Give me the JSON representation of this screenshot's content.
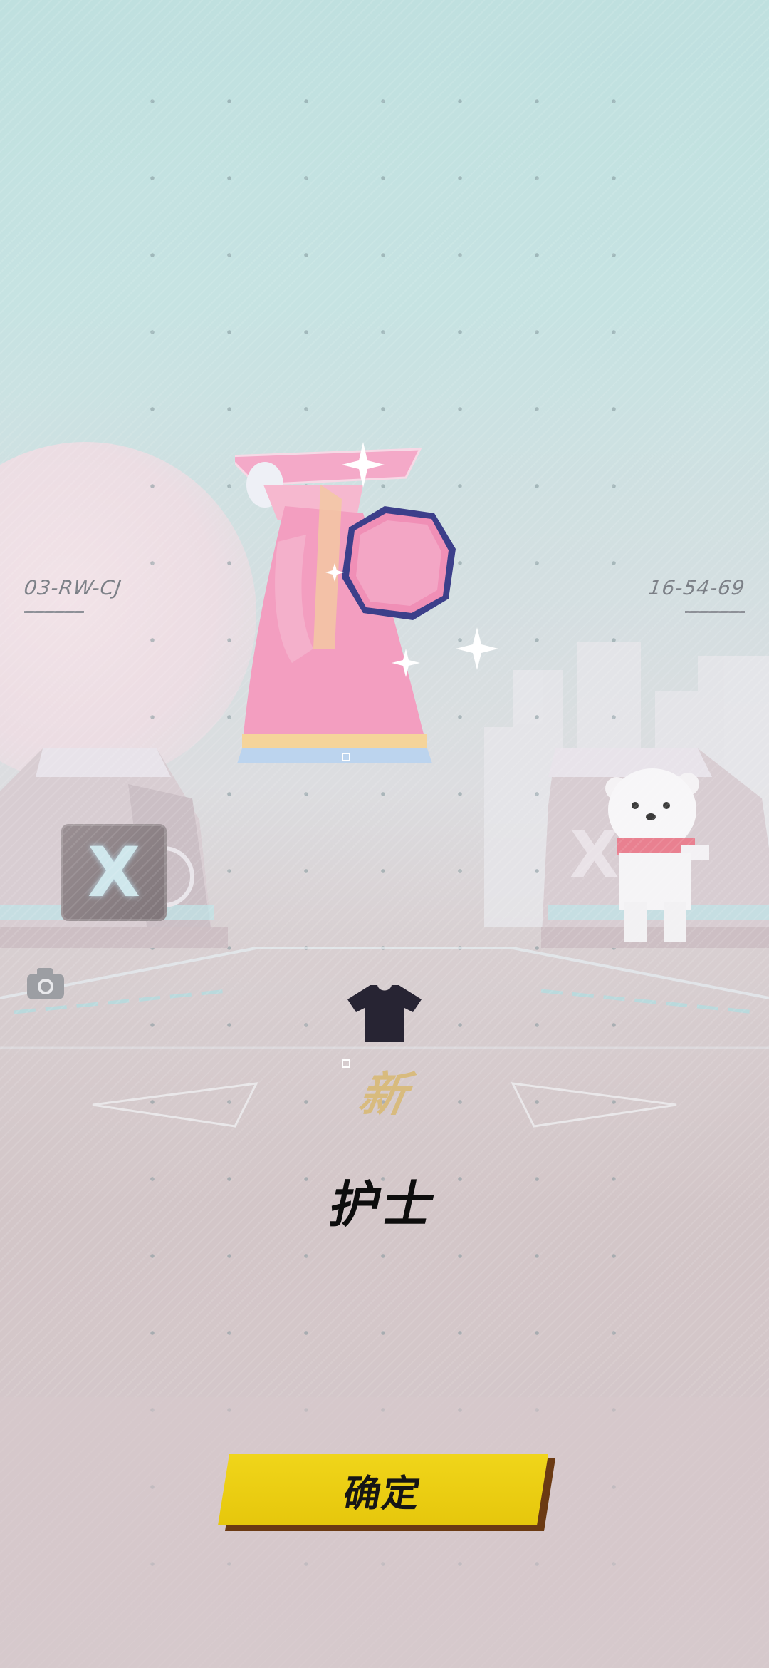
{
  "scene": {
    "code_left": "03-RW-CJ",
    "code_right": "16-54-69",
    "badge_letter": "X"
  },
  "reward": {
    "item_icon": "shirt-icon",
    "new_tag": "新",
    "item_name": "护士"
  },
  "actions": {
    "confirm_label": "确定",
    "camera_icon": "camera-icon"
  },
  "colors": {
    "confirm_button": "#e6c70c",
    "new_tag": "#d8bb7e",
    "sky": "#bfe0df"
  }
}
